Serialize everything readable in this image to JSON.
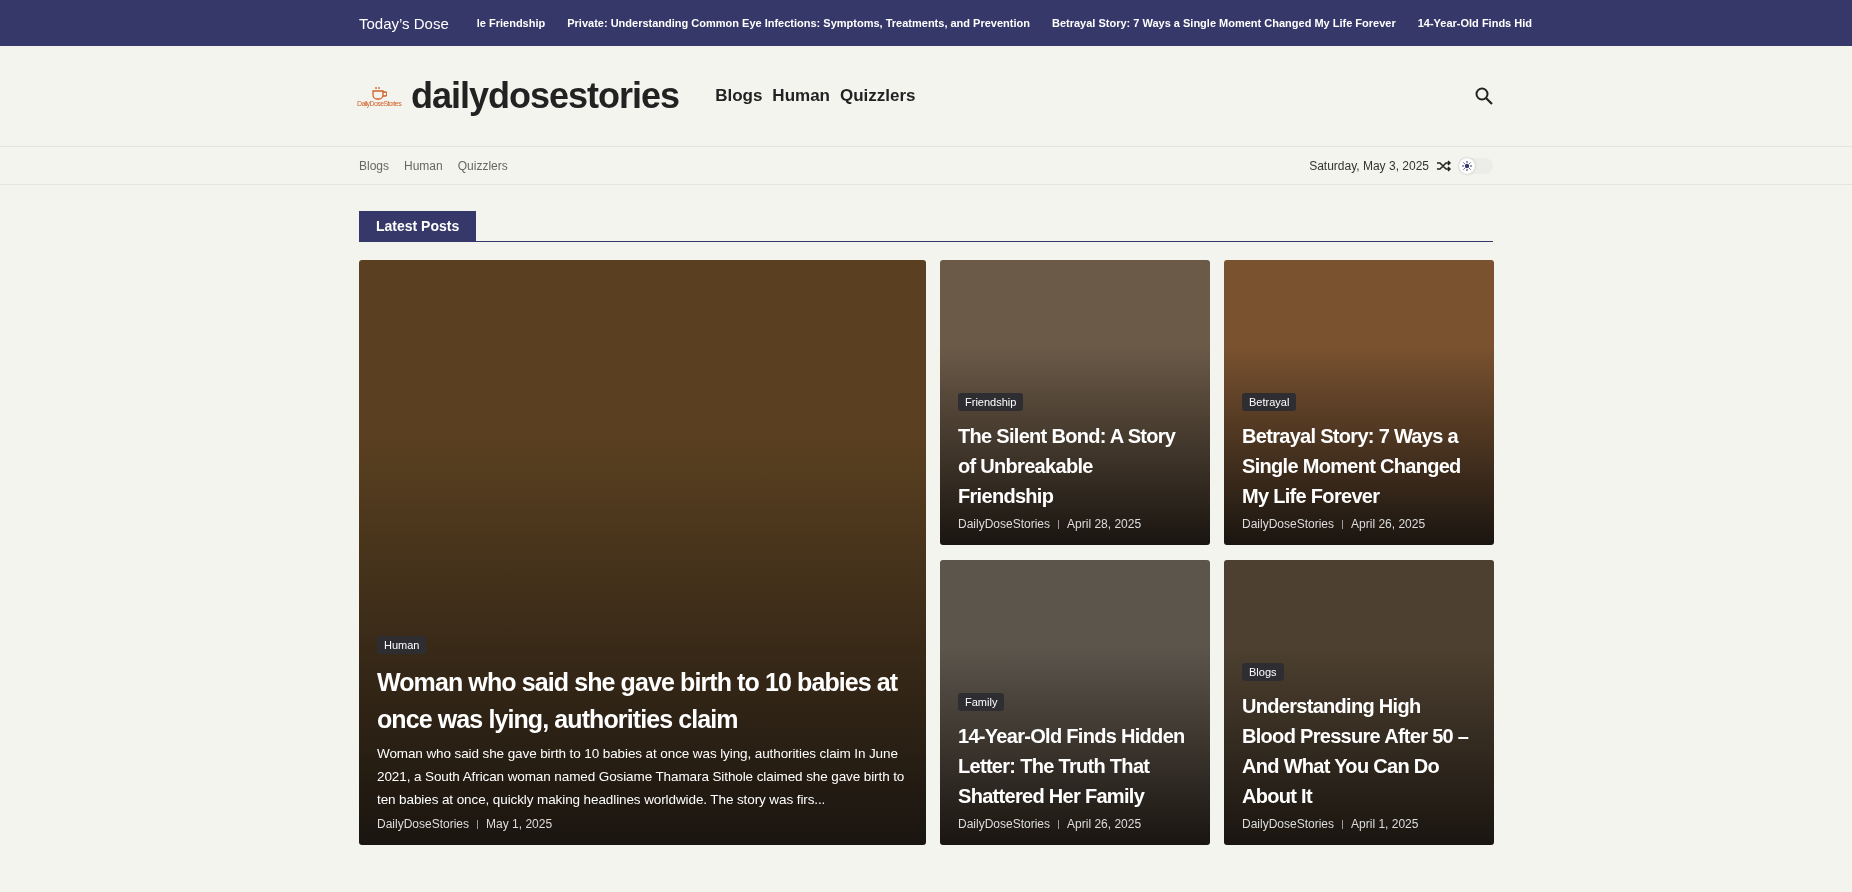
{
  "ticker": {
    "label": "Today’s Dose",
    "items": [
      "le Friendship",
      "Private: Understanding Common Eye Infections: Symptoms, Treatments, and Prevention",
      "Betrayal Story: 7 Ways a Single Moment Changed My Life Forever",
      "14-Year-Old Finds Hid"
    ]
  },
  "header": {
    "logo_caption": "DailyDoseStories",
    "site_name": "dailydosestories",
    "nav": [
      "Blogs",
      "Human",
      "Quizzlers"
    ]
  },
  "subnav": {
    "links": [
      "Blogs",
      "Human",
      "Quizzlers"
    ],
    "date": "Saturday, May 3, 2025",
    "dark_mode": false
  },
  "section": {
    "title": "Latest Posts"
  },
  "posts": [
    {
      "kind": "featured",
      "category": "Human",
      "title": "Woman who said she gave birth to 10 babies at once was lying, authorities claim",
      "excerpt": "Woman who said she gave birth to 10 babies at once was lying, authorities claim In June 2021, a South African woman named Gosiame Thamara Sithole claimed she gave birth to ten babies at once, quickly making headlines worldwide. The story was firs...",
      "author": "DailyDoseStories",
      "date": "May 1, 2025",
      "color": "#5a4020"
    },
    {
      "kind": "small",
      "category": "Friendship",
      "title": "The Silent Bond: A Story of Unbreakable Friendship",
      "author": "DailyDoseStories",
      "date": "April 28, 2025",
      "color": "#6b5a48"
    },
    {
      "kind": "small",
      "category": "Betrayal",
      "title": "Betrayal Story: 7 Ways a Single Moment Changed My Life Forever",
      "author": "DailyDoseStories",
      "date": "April 26, 2025",
      "color": "#7a5230"
    },
    {
      "kind": "small",
      "category": "Family",
      "title": "14-Year-Old Finds Hidden Letter: The Truth That Shattered Her Family",
      "author": "DailyDoseStories",
      "date": "April 26, 2025",
      "color": "#5c554c"
    },
    {
      "kind": "small",
      "category": "Blogs",
      "title": "Understanding High Blood Pressure After 50 – And What You Can Do About It",
      "author": "DailyDoseStories",
      "date": "April 1, 2025",
      "color": "#4d4030"
    }
  ]
}
